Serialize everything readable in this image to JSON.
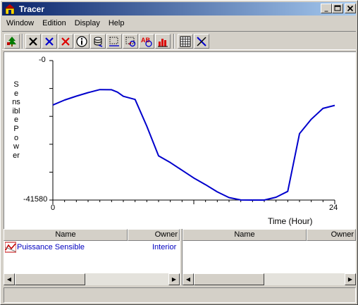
{
  "window": {
    "title": "Tracer",
    "minimize_icon": "minimize-icon",
    "maximize_icon": "maximize-icon",
    "close_icon": "close-icon"
  },
  "menu": [
    "Window",
    "Edition",
    "Display",
    "Help"
  ],
  "toolbar": {
    "icons": [
      "tree-icon",
      "delete-black-icon",
      "delete-blue-icon",
      "delete-red-icon",
      "info-icon",
      "database-icon",
      "zoom-region-icon",
      "zoom-curve-icon",
      "alarm-icon",
      "bar-chart-icon",
      "grid-icon",
      "crosshair-icon"
    ]
  },
  "chart_data": {
    "type": "line",
    "xlabel": "Time (Hour)",
    "ylabel": "Sensible Power",
    "xlim": [
      0,
      24
    ],
    "ylim": [
      -41580,
      0
    ],
    "x_tick_labels": [
      "0",
      "24"
    ],
    "y_tick_labels": [
      "-0",
      "-41580"
    ],
    "series": [
      {
        "name": "Puissance Sensible",
        "color": "#0000cc",
        "x": [
          0,
          1,
          2,
          3,
          4,
          5,
          5.5,
          6,
          7,
          8,
          9,
          10,
          11,
          12,
          13,
          14,
          15,
          16,
          17,
          17.5,
          18,
          19,
          20,
          21,
          22,
          23,
          24
        ],
        "y": [
          -13250,
          -11750,
          -10600,
          -9550,
          -8650,
          -8700,
          -9400,
          -10650,
          -11600,
          -19550,
          -28400,
          -30400,
          -32700,
          -35000,
          -37000,
          -39150,
          -40850,
          -41560,
          -41580,
          -41580,
          -41580,
          -40750,
          -39000,
          -21800,
          -17500,
          -14250,
          -13350
        ]
      }
    ]
  },
  "lists": {
    "left": {
      "col_name": "Name",
      "col_owner": "Owner",
      "rows": [
        {
          "name": "Puissance Sensible",
          "owner": "Interior",
          "icon": "curve-icon"
        }
      ]
    },
    "right": {
      "col_name": "Name",
      "col_owner": "Owner",
      "rows": []
    }
  }
}
